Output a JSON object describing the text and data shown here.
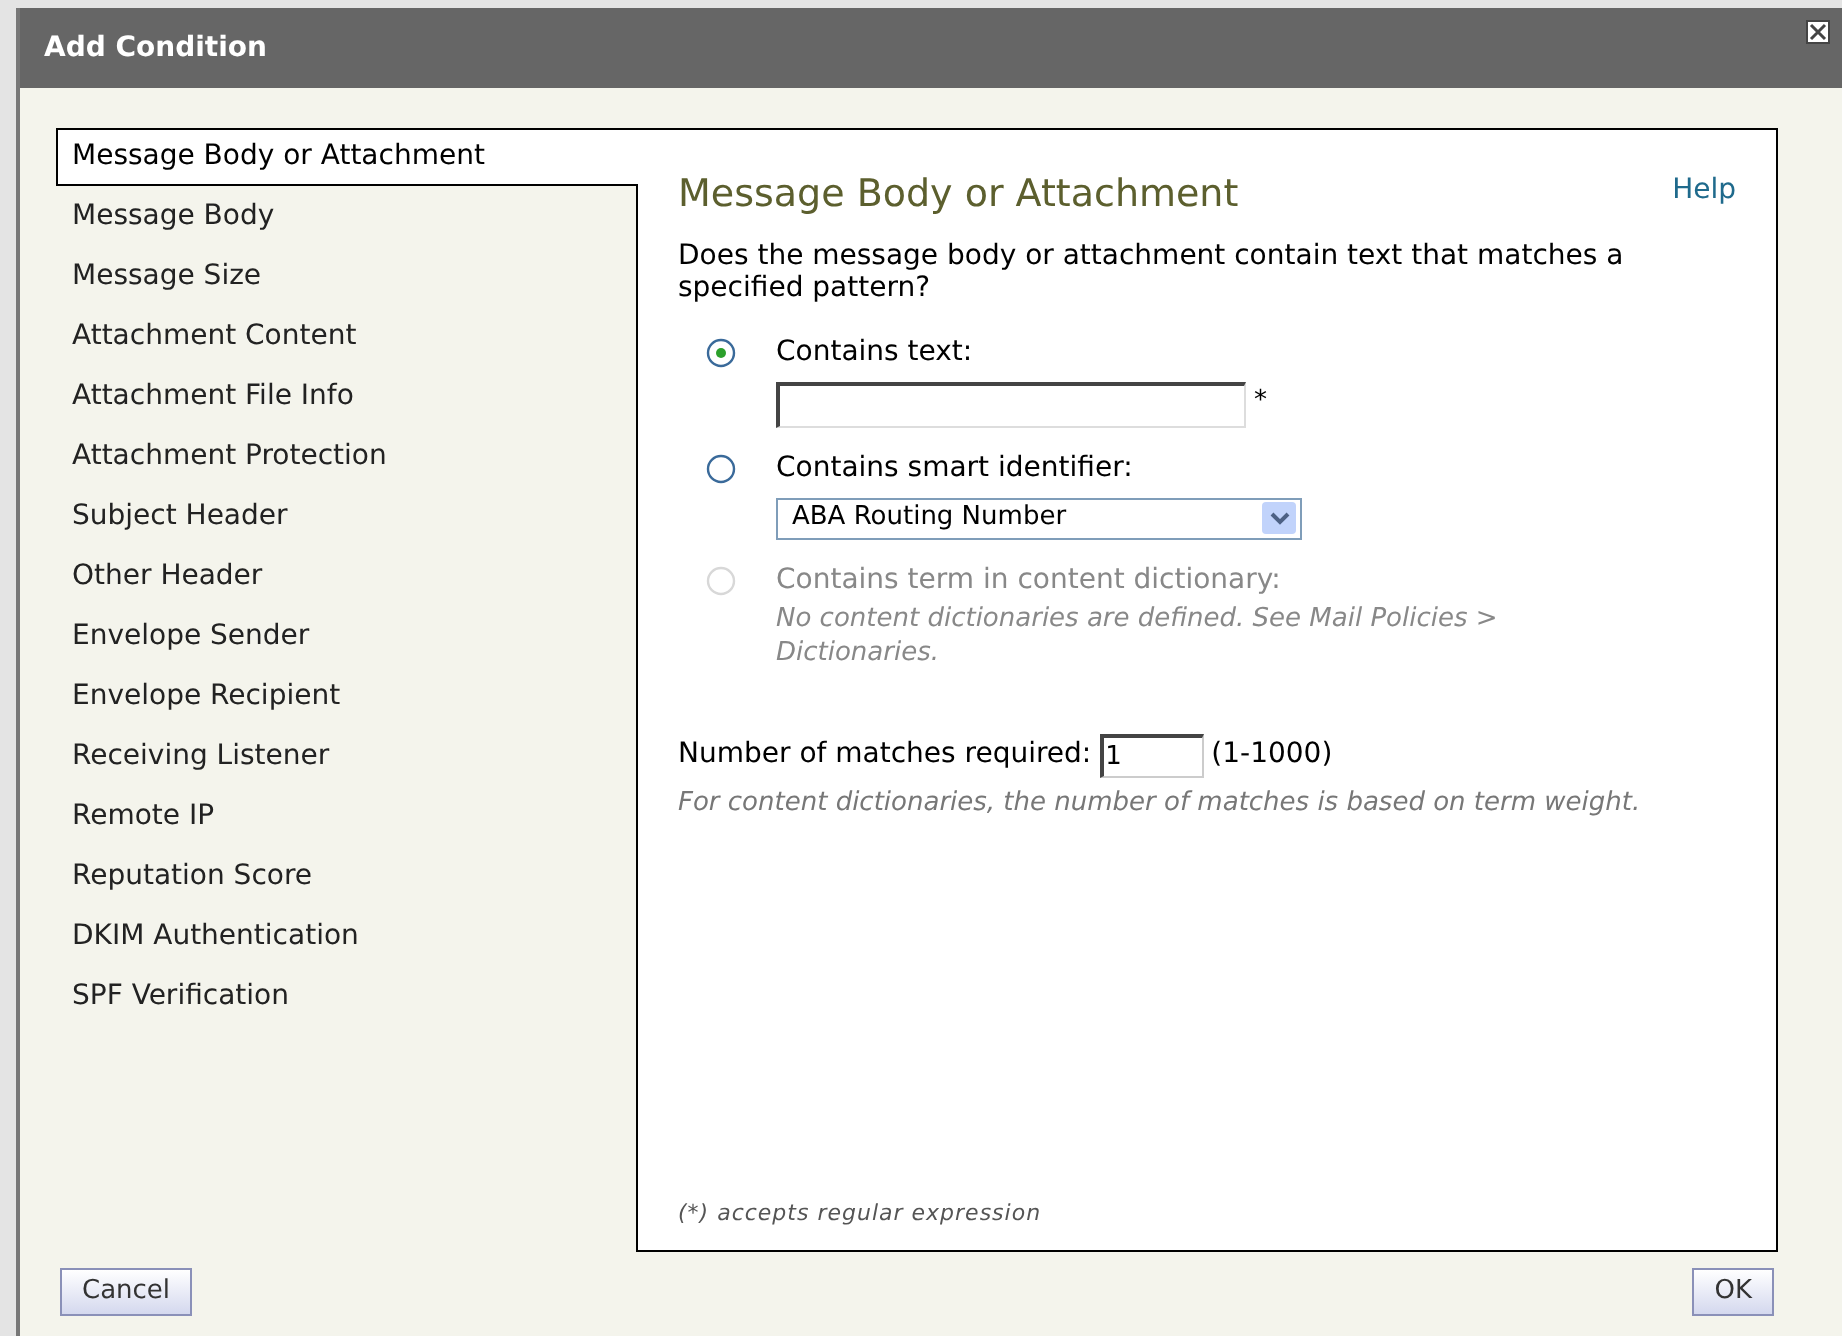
{
  "window": {
    "title": "Add Condition"
  },
  "sidebar": {
    "items": [
      {
        "label": "Message Body or Attachment",
        "selected": true
      },
      {
        "label": "Message Body",
        "selected": false
      },
      {
        "label": "Message Size",
        "selected": false
      },
      {
        "label": "Attachment Content",
        "selected": false
      },
      {
        "label": "Attachment File Info",
        "selected": false
      },
      {
        "label": "Attachment Protection",
        "selected": false
      },
      {
        "label": "Subject Header",
        "selected": false
      },
      {
        "label": "Other Header",
        "selected": false
      },
      {
        "label": "Envelope Sender",
        "selected": false
      },
      {
        "label": "Envelope Recipient",
        "selected": false
      },
      {
        "label": "Receiving Listener",
        "selected": false
      },
      {
        "label": "Remote IP",
        "selected": false
      },
      {
        "label": "Reputation Score",
        "selected": false
      },
      {
        "label": "DKIM Authentication",
        "selected": false
      },
      {
        "label": "SPF Verification",
        "selected": false
      }
    ]
  },
  "panel": {
    "heading": "Message Body or Attachment",
    "help_link": "Help",
    "description": "Does the message body or attachment contain text that matches a specified pattern?",
    "options": [
      {
        "kind": "text",
        "label": "Contains text:",
        "selected": true,
        "disabled": false,
        "required_mark": "*"
      },
      {
        "kind": "select",
        "label": "Contains smart identifier:",
        "selected": false,
        "disabled": false,
        "value": "ABA Routing Number"
      },
      {
        "kind": "note",
        "label": "Contains term in content dictionary:",
        "selected": false,
        "disabled": true,
        "note": "No content dictionaries are defined. See Mail Policies > Dictionaries."
      }
    ],
    "matches": {
      "label": "Number of matches required:",
      "value": "1",
      "range": "(1-1000)",
      "note": "For content dictionaries, the number of matches is based on term weight."
    },
    "footnote": "(*) accepts regular expression"
  },
  "buttons": {
    "cancel": "Cancel",
    "ok": "OK"
  }
}
